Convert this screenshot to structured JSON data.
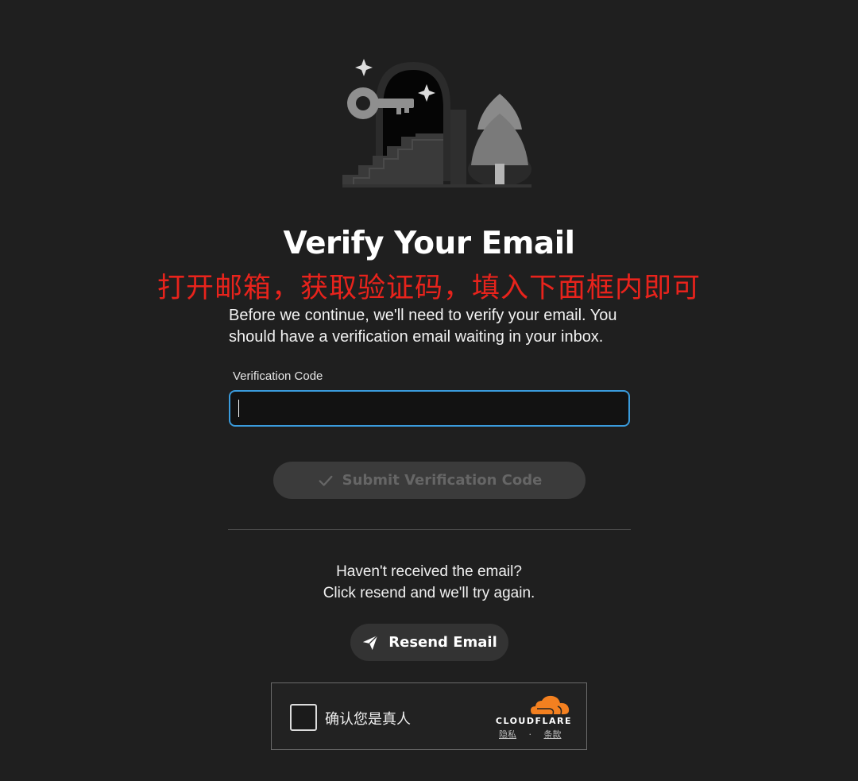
{
  "page": {
    "title": "Verify Your Email",
    "annotation": "打开邮箱，获取验证码，填入下面框内即可",
    "description": "Before we continue, we'll need to verify your email. You should have a verification email waiting in your inbox."
  },
  "form": {
    "code_label": "Verification Code",
    "code_value": "",
    "submit_label": "Submit Verification Code"
  },
  "resend": {
    "line1": "Haven't received the email?",
    "line2": "Click resend and we'll try again.",
    "button_label": "Resend Email"
  },
  "captcha": {
    "label": "确认您是真人",
    "brand": "CLOUDFLARE",
    "privacy_link": "隐私",
    "separator": "·",
    "terms_link": "条款"
  },
  "icons": {
    "submit": "check-icon",
    "resend": "paper-plane-icon",
    "brand": "cloudflare-cloud-icon"
  },
  "colors": {
    "background": "#1f1f1f",
    "input_border": "#3a9bdc",
    "annotation": "#e8231c",
    "cloudflare_orange": "#f38020"
  }
}
